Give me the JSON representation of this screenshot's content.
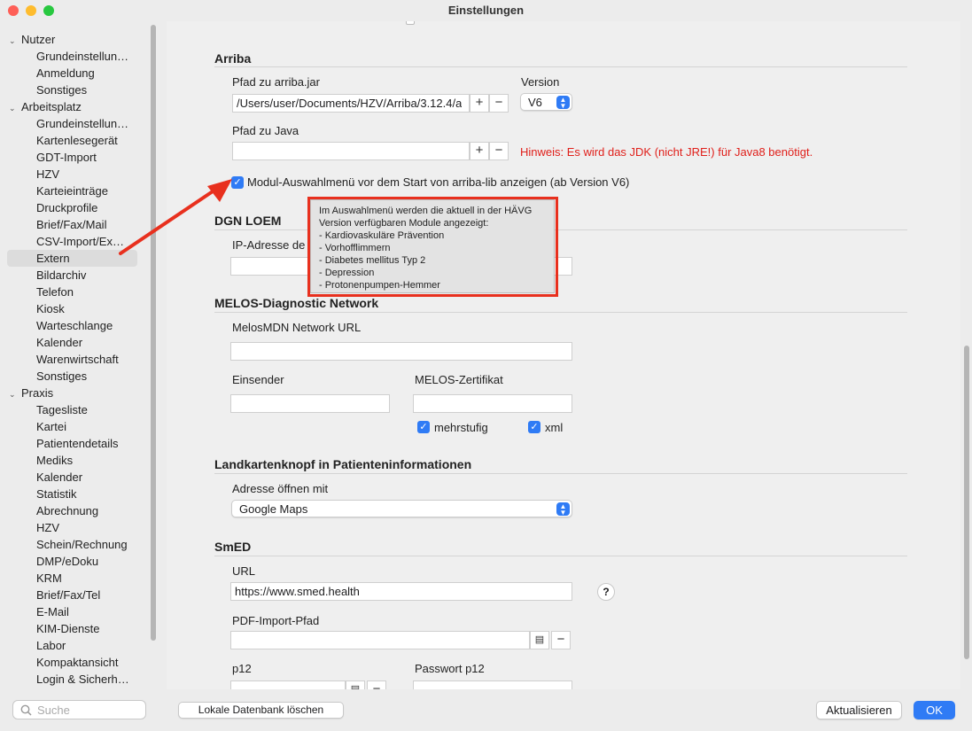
{
  "window": {
    "title": "Einstellungen"
  },
  "sidebar": {
    "groups": [
      {
        "label": "Nutzer",
        "items": [
          "Grundeinstellun…",
          "Anmeldung",
          "Sonstiges"
        ]
      },
      {
        "label": "Arbeitsplatz",
        "items": [
          "Grundeinstellun…",
          "Kartenlesegerät",
          "GDT-Import",
          "HZV",
          "Karteieinträge",
          "Druckprofile",
          "Brief/Fax/Mail",
          "CSV-Import/Ex…",
          "Extern",
          "Bildarchiv",
          "Telefon",
          "Kiosk",
          "Warteschlange",
          "Kalender",
          "Warenwirtschaft",
          "Sonstiges"
        ]
      },
      {
        "label": "Praxis",
        "items": [
          "Tagesliste",
          "Kartei",
          "Patientendetails",
          "Mediks",
          "Kalender",
          "Statistik",
          "Abrechnung",
          "HZV",
          "Schein/Rechnung",
          "DMP/eDoku",
          "KRM",
          "Brief/Fax/Tel",
          "E-Mail",
          "KIM-Dienste",
          "Labor",
          "Kompaktansicht",
          "Login & Sicherh…"
        ]
      }
    ],
    "selected": "Extern",
    "search_placeholder": "Suche"
  },
  "main": {
    "arriba": {
      "title": "Arriba",
      "jar_label": "Pfad zu arriba.jar",
      "jar_value": "/Users/user/Documents/HZV/Arriba/3.12.4/a",
      "version_label": "Version",
      "version_value": "V6",
      "java_label": "Pfad zu Java",
      "java_value": "",
      "java_hint": "Hinweis: Es wird das JDK (nicht JRE!) für Java8 benötigt.",
      "module_checkbox": "Modul-Auswahlmenü vor dem Start von arriba-lib anzeigen (ab Version V6)"
    },
    "tooltip": {
      "lines": [
        "Im Auswahlmenü werden die aktuell in der HÄVG",
        "Version verfügbaren Module angezeigt:",
        "- Kardiovaskuläre Prävention",
        "- Vorhofflimmern",
        "- Diabetes mellitus Typ 2",
        "- Depression",
        "- Protonenpumpen-Hemmer"
      ]
    },
    "dgn": {
      "title": "DGN LOEM",
      "ip_label": "IP-Adresse de"
    },
    "melos": {
      "title": "MELOS-Diagnostic Network",
      "url_label": "MelosMDN Network URL",
      "einsender_label": "Einsender",
      "zert_label": "MELOS-Zertifikat",
      "mehrstufig": "mehrstufig",
      "xml": "xml"
    },
    "map": {
      "title": "Landkartenknopf in Patienteninformationen",
      "open_label": "Adresse öffnen mit",
      "open_value": "Google Maps"
    },
    "smed": {
      "title": "SmED",
      "url_label": "URL",
      "url_value": "https://www.smed.health",
      "pdf_label": "PDF-Import-Pfad",
      "p12_label": "p12",
      "pw_label": "Passwort p12"
    }
  },
  "footer": {
    "delete_db": "Lokale Datenbank löschen",
    "refresh": "Aktualisieren",
    "ok": "OK"
  },
  "colors": {
    "accent": "#2f7bf5",
    "warning": "#e0201b",
    "annotation": "#e8301e"
  }
}
